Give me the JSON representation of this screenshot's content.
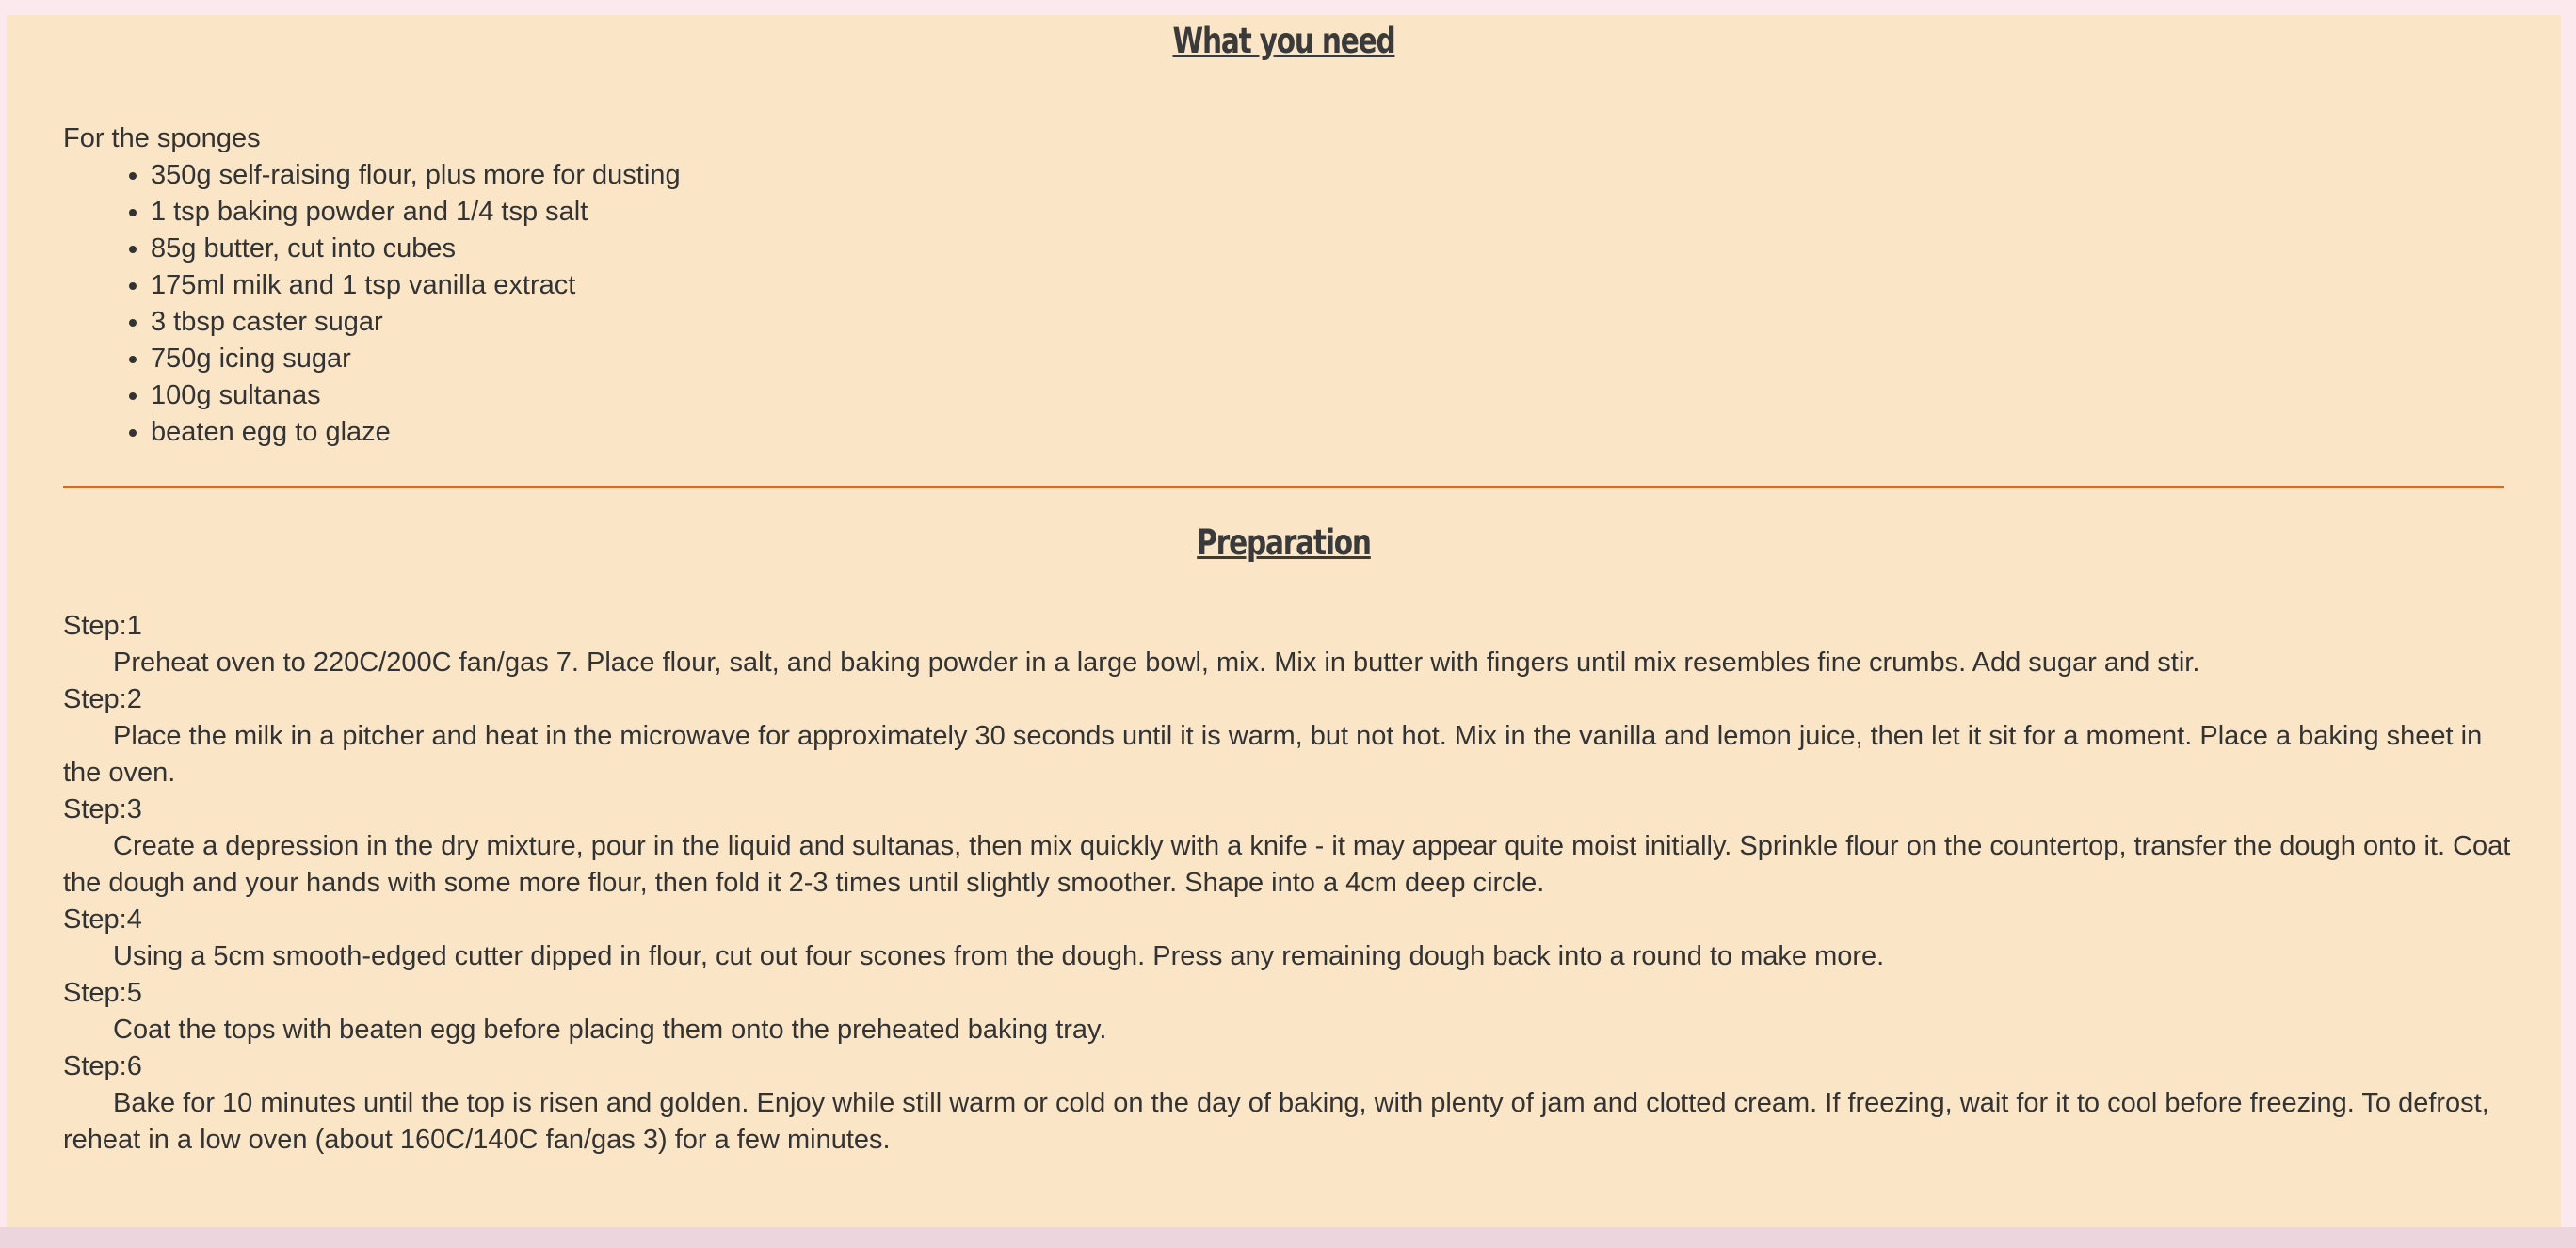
{
  "ingredients_section": {
    "title": "What you need",
    "subheading": "For the sponges",
    "items": [
      "350g self-raising flour, plus more for dusting",
      "1 tsp baking powder and 1/4 tsp salt",
      "85g butter, cut into cubes",
      "175ml milk and 1 tsp vanilla extract",
      "3 tbsp caster sugar",
      "750g icing sugar",
      "100g sultanas",
      "beaten egg to glaze"
    ]
  },
  "preparation_section": {
    "title": "Preparation",
    "steps": [
      {
        "label": "Step:1",
        "text": "Preheat oven to 220C/200C fan/gas 7. Place flour, salt, and baking powder in a large bowl, mix. Mix in butter with fingers until mix resembles fine crumbs. Add sugar and stir."
      },
      {
        "label": "Step:2",
        "text": "Place the milk in a pitcher and heat in the microwave for approximately 30 seconds until it is warm, but not hot. Mix in the vanilla and lemon juice, then let it sit for a moment. Place a baking sheet in the oven."
      },
      {
        "label": "Step:3",
        "text": "Create a depression in the dry mixture, pour in the liquid and sultanas, then mix quickly with a knife - it may appear quite moist initially. Sprinkle flour on the countertop, transfer the dough onto it. Coat the dough and your hands with some more flour, then fold it 2-3 times until slightly smoother. Shape into a 4cm deep circle."
      },
      {
        "label": "Step:4",
        "text": "Using a 5cm smooth-edged cutter dipped in flour, cut out four scones from the dough. Press any remaining dough back into a round to make more."
      },
      {
        "label": "Step:5",
        "text": "Coat the tops with beaten egg before placing them onto the preheated baking tray."
      },
      {
        "label": "Step:6",
        "text": "Bake for 10 minutes until the top is risen and golden. Enjoy while still warm or cold on the day of baking, with plenty of jam and clotted cream. If freezing, wait for it to cool before freezing. To defrost, reheat in a low oven (about 160C/140C fan/gas 3) for a few minutes."
      }
    ]
  }
}
